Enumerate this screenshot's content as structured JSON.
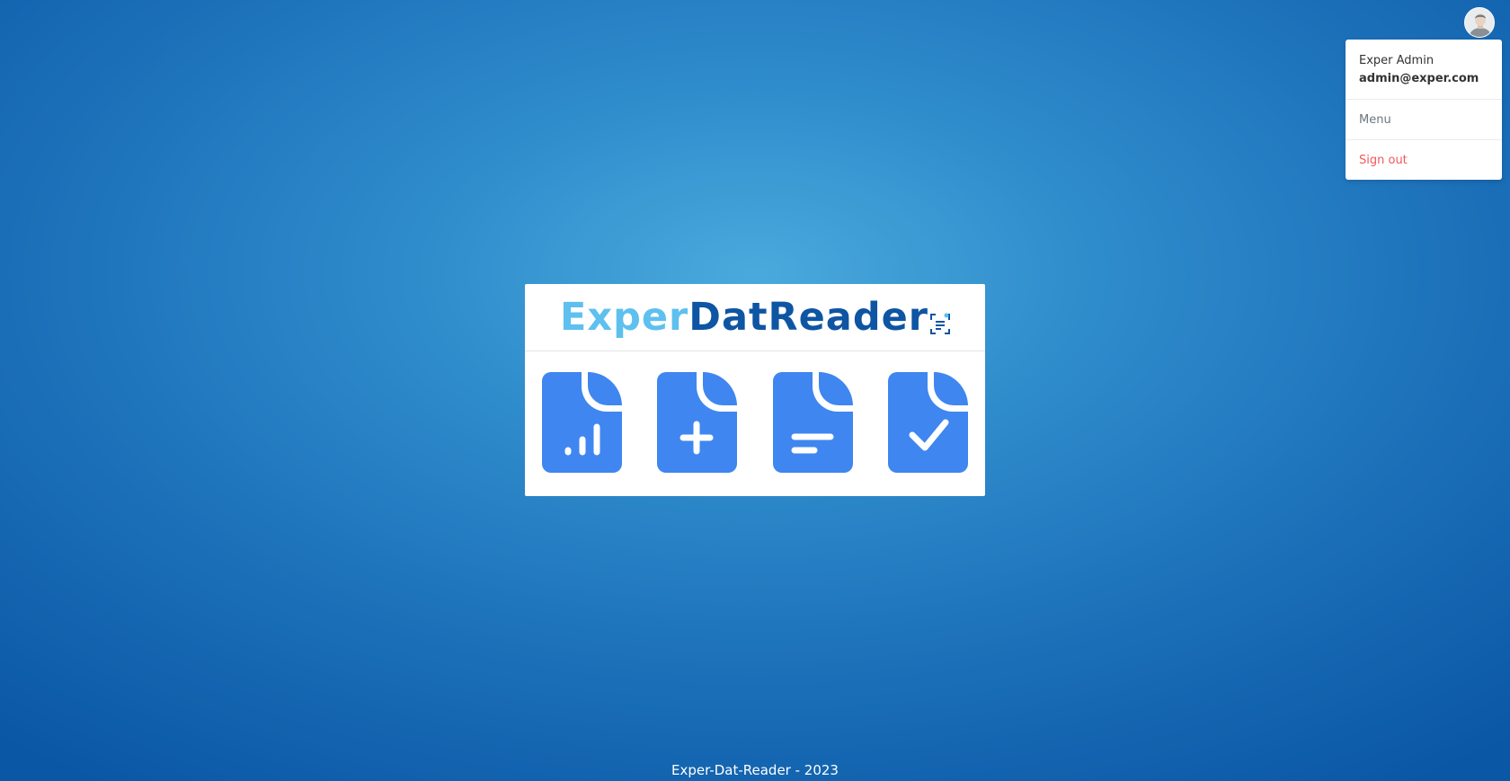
{
  "user": {
    "name": "Exper Admin",
    "email": "admin@exper.com"
  },
  "dropdown": {
    "menu_label": "Menu",
    "signout_label": "Sign out"
  },
  "logo": {
    "part1": "Exper",
    "part2": "DatReader"
  },
  "tiles": [
    {
      "icon": "document-chart-icon"
    },
    {
      "icon": "document-add-icon"
    },
    {
      "icon": "document-text-icon"
    },
    {
      "icon": "document-check-icon"
    }
  ],
  "footer": {
    "text": "Exper-Dat-Reader - 2023"
  },
  "colors": {
    "accent": "#3f86f0",
    "logo_light": "#5ec0ef",
    "logo_dark": "#0e55a3",
    "signout": "#ee5a5a"
  }
}
